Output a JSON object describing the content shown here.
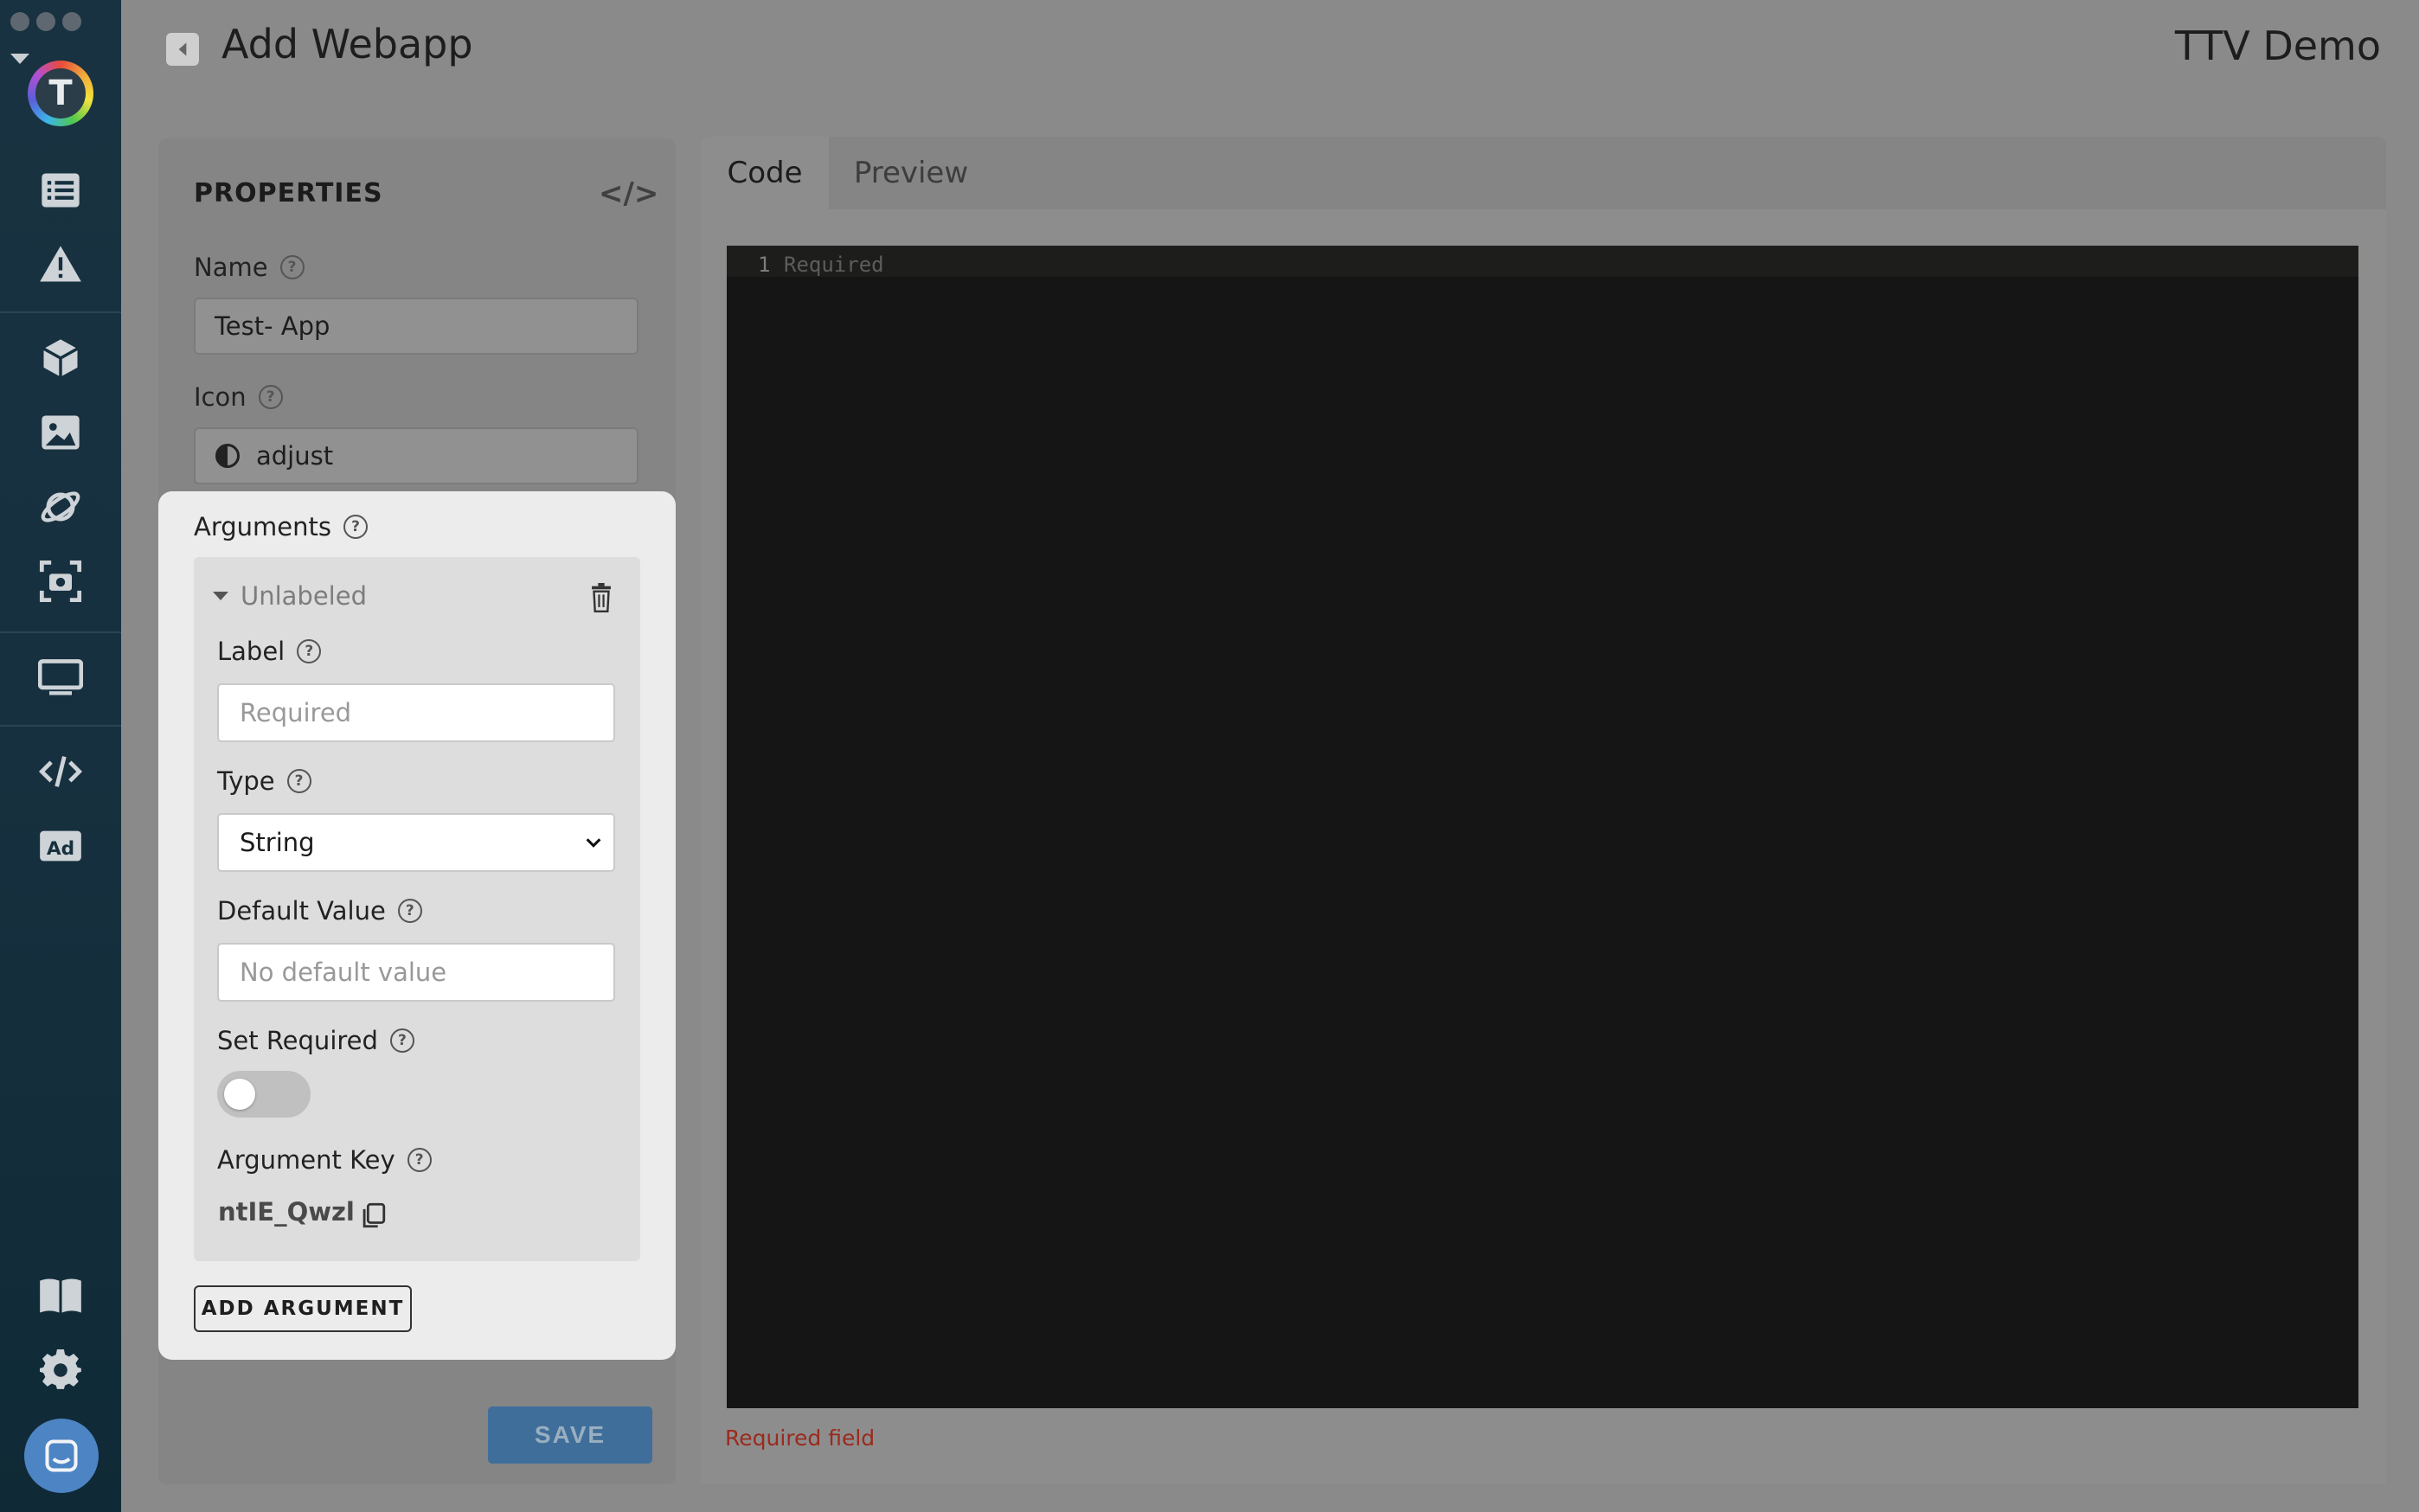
{
  "header": {
    "title": "Add Webapp",
    "workspace": "TTV Demo"
  },
  "sidebar": {
    "logo_letter": "T",
    "icons": [
      "list-icon",
      "warning-icon",
      "cube-icon",
      "image-icon",
      "planet-icon",
      "camera-scan-icon",
      "monitor-icon",
      "code-icon",
      "ad-icon",
      "book-icon",
      "gear-icon",
      "chat-icon"
    ]
  },
  "properties": {
    "title": "PROPERTIES",
    "code_toggle": "</>",
    "name_label": "Name",
    "name_value": "Test- App",
    "icon_label": "Icon",
    "icon_value": "adjust",
    "save_label": "SAVE"
  },
  "arguments": {
    "title": "Arguments",
    "item_title": "Unlabeled",
    "label_label": "Label",
    "label_placeholder": "Required",
    "type_label": "Type",
    "type_value": "String",
    "default_label": "Default Value",
    "default_placeholder": "No default value",
    "required_label": "Set Required",
    "required_value": false,
    "key_label": "Argument Key",
    "key_value": "ntIE_Qwzl",
    "add_label": "ADD ARGUMENT"
  },
  "editor": {
    "tabs": [
      {
        "label": "Code",
        "active": true
      },
      {
        "label": "Preview",
        "active": false
      }
    ],
    "line_number": "1",
    "placeholder": "Required",
    "error": "Required field"
  },
  "colors": {
    "sidebar": "#17303f",
    "accent": "#4d84c4",
    "error": "#9b2a1e",
    "editor_bg": "#141514"
  }
}
